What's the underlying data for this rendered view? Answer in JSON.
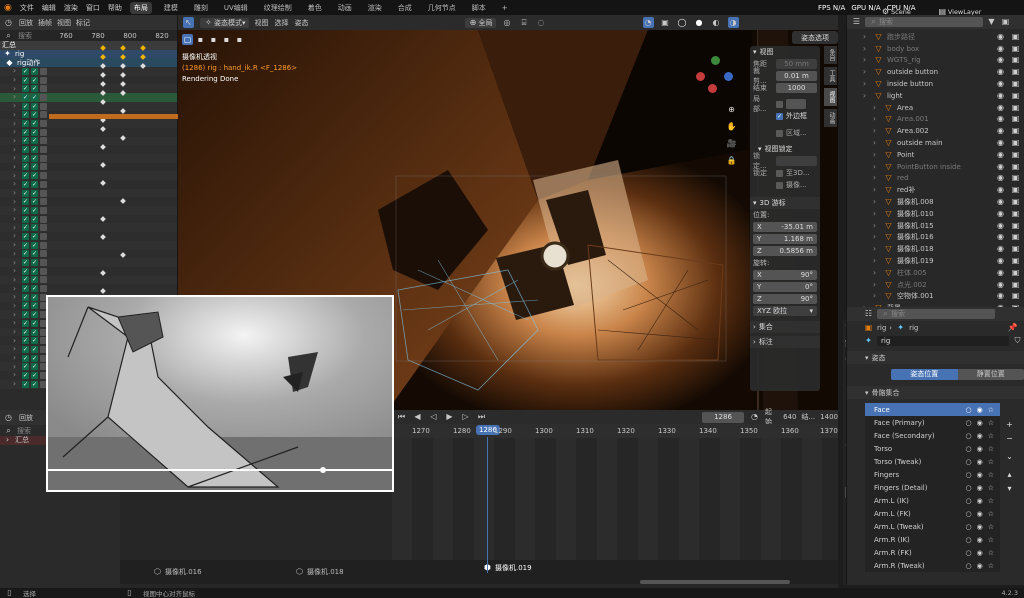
{
  "topbar": {
    "menus": [
      "文件",
      "编辑",
      "渲染",
      "窗口",
      "帮助"
    ],
    "workspaces": [
      "布局",
      "建模",
      "雕刻",
      "UV编辑",
      "纹理绘制",
      "着色",
      "动画",
      "渲染",
      "合成",
      "几何节点",
      "脚本"
    ],
    "active_workspace": "布局",
    "add_tab": "+",
    "scene_label": "Scene",
    "viewlayer_label": "ViewLayer",
    "fps": "FPS N/A",
    "gpu": "GPU N/A",
    "cpu": "CPU N/A"
  },
  "dopesheet": {
    "back": "回放",
    "key": "插帧",
    "view": "视图",
    "marker": "标记",
    "frames": [
      "760",
      "780",
      "800",
      "820"
    ],
    "search_placeholder": "搜索",
    "summary": "汇总",
    "rig": "rig",
    "action": "rig动作"
  },
  "viewport_header": {
    "mode": "姿态模式",
    "view": "视图",
    "select": "选择",
    "pose": "姿态",
    "global": "全局"
  },
  "viewport": {
    "camera_title": "摄像机透视",
    "rig_line": "(1286) rig : hand_ik.R <F_1286>",
    "render_status": "Rendering Done"
  },
  "npanel": {
    "header": "姿态选项",
    "view_section": "视图",
    "focal_label": "焦距",
    "focal_value": "50 mm",
    "clip_start_label": "裁剪...",
    "clip_start_value": "0.01 m",
    "clip_end_label": "结束",
    "clip_end_value": "1000",
    "local_label": "局部...",
    "outline_label": "外边框",
    "region_label": "区域...",
    "view_lock_section": "视图锁定",
    "lock_to_label": "锁定...",
    "lock_label": "锁定",
    "to3d_label": "至3D...",
    "camera_label": "摄像...",
    "cursor_section": "3D 游标",
    "location_label": "位置:",
    "x_label": "X",
    "x_value": "-35.01 m",
    "y_label": "Y",
    "y_value": "1.168 m",
    "z_label": "Z",
    "z_value": "0.5856 m",
    "rotation_label": "旋转:",
    "rx_value": "90°",
    "ry_value": "0°",
    "rz_value": "90°",
    "rot_mode": "XYZ 欧拉",
    "collection_section": "集合",
    "annotation_section": "标注",
    "side_tabs": [
      "条目",
      "工具",
      "视图",
      "动画"
    ]
  },
  "timeline": {
    "current_frame": "1286",
    "start_label": "起始",
    "start_value": "640",
    "end_label": "结...",
    "end_value": "1400",
    "ruler": [
      "1270",
      "1280",
      "1286",
      "1290",
      "1300",
      "1310",
      "1320",
      "1330",
      "1340",
      "1350",
      "1360",
      "1370"
    ],
    "markers": [
      "摄像机.016",
      "摄像机.018",
      "摄像机.019"
    ]
  },
  "ds2": {
    "back": "回放",
    "search_placeholder": "搜索",
    "summary": "汇总"
  },
  "outliner": {
    "search_placeholder": "搜索",
    "items": [
      {
        "name": "跑步路径",
        "dim": true
      },
      {
        "name": "body box",
        "dim": true
      },
      {
        "name": "WGTS_rig",
        "dim": true
      },
      {
        "name": "outside button",
        "dim": false
      },
      {
        "name": "inside button",
        "dim": false
      },
      {
        "name": "light",
        "dim": false
      },
      {
        "name": "Area",
        "dim": false
      },
      {
        "name": "Area.001",
        "dim": true
      },
      {
        "name": "Area.002",
        "dim": false
      },
      {
        "name": "outside main",
        "dim": false
      },
      {
        "name": "Point",
        "dim": false
      },
      {
        "name": "PointButton inside",
        "dim": true
      },
      {
        "name": "red",
        "dim": true
      },
      {
        "name": "red补",
        "dim": false
      },
      {
        "name": "摄像机.008",
        "dim": false
      },
      {
        "name": "摄像机.010",
        "dim": false
      },
      {
        "name": "摄像机.015",
        "dim": false
      },
      {
        "name": "摄像机.016",
        "dim": false
      },
      {
        "name": "摄像机.018",
        "dim": false
      },
      {
        "name": "摄像机.019",
        "dim": false
      },
      {
        "name": "柱体.005",
        "dim": true
      },
      {
        "name": "点光.002",
        "dim": true
      },
      {
        "name": "空物体.001",
        "dim": false
      },
      {
        "name": "背景",
        "dim": false
      }
    ]
  },
  "properties": {
    "search_placeholder": "搜索",
    "rig_name": "rig",
    "armature_name": "rig",
    "armature_field": "rig",
    "pose_section": "姿态",
    "pose_position": "姿态位置",
    "rest_position": "静置位置",
    "bone_collections": "骨骼集合",
    "bones": [
      "Face",
      "Face (Primary)",
      "Face (Secondary)",
      "Torso",
      "Torso (Tweak)",
      "Fingers",
      "Fingers (Detail)",
      "Arm.L (IK)",
      "Arm.L (FK)",
      "Arm.L (Tweak)",
      "Arm.R (IK)",
      "Arm.R (FK)",
      "Arm.R (Tweak)"
    ]
  },
  "status": {
    "select": "选择",
    "center": "视图中心对齐鼠标",
    "version": "4.2.3"
  }
}
